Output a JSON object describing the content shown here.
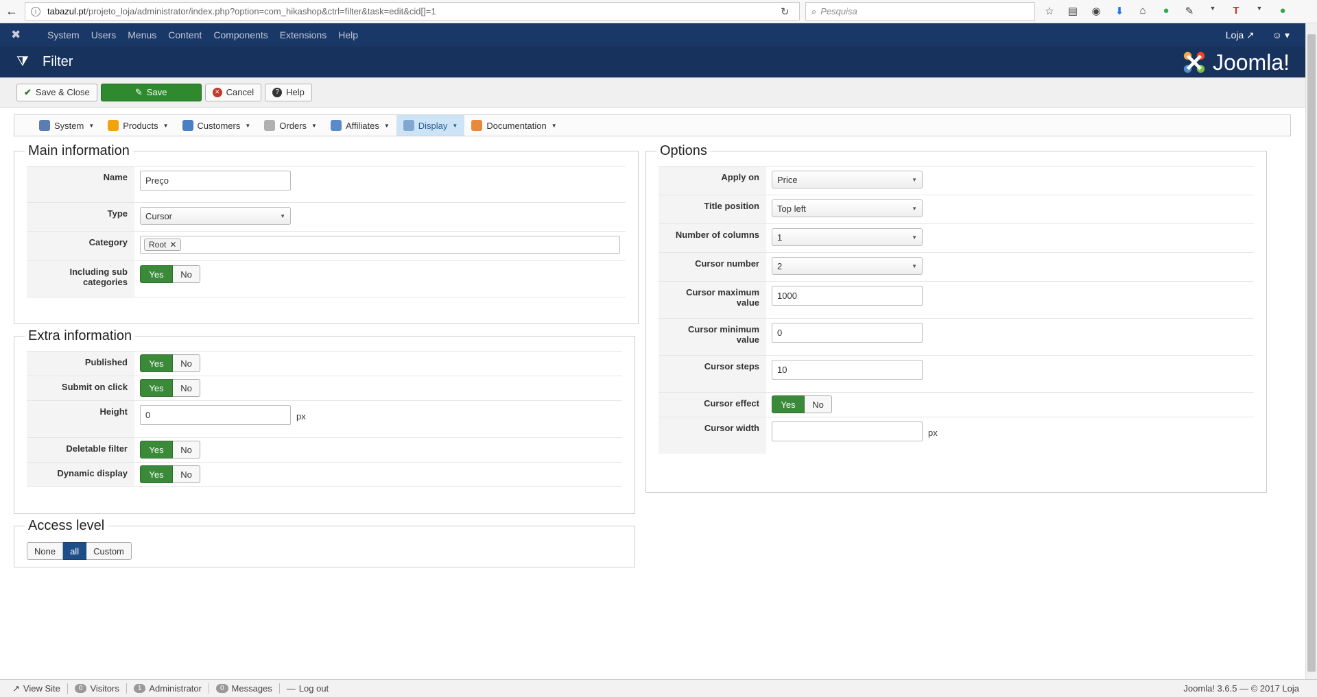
{
  "browser": {
    "url_host": "tabazul.pt",
    "url_path": "/projeto_loja/administrator/index.php?option=com_hikashop&ctrl=filter&task=edit&cid[]=1",
    "search_placeholder": "Pesquisa"
  },
  "joomla_nav": {
    "items": [
      "System",
      "Users",
      "Menus",
      "Content",
      "Components",
      "Extensions",
      "Help"
    ],
    "site_link": "Loja"
  },
  "title": "Filter",
  "brand": "Joomla!",
  "toolbar": {
    "save_close": "Save & Close",
    "save": "Save",
    "cancel": "Cancel",
    "help": "Help"
  },
  "hikashop_menu": [
    "System",
    "Products",
    "Customers",
    "Orders",
    "Affiliates",
    "Display",
    "Documentation"
  ],
  "main_info": {
    "legend": "Main information",
    "name_label": "Name",
    "name_value": "Preço",
    "type_label": "Type",
    "type_value": "Cursor",
    "category_label": "Category",
    "category_tag": "Root",
    "including_label": "Including sub categories"
  },
  "extra_info": {
    "legend": "Extra information",
    "published_label": "Published",
    "submit_label": "Submit on click",
    "height_label": "Height",
    "height_value": "0",
    "height_unit": "px",
    "deletable_label": "Deletable filter",
    "dynamic_label": "Dynamic display"
  },
  "access": {
    "legend": "Access level",
    "options": [
      "None",
      "all",
      "Custom"
    ]
  },
  "options": {
    "legend": "Options",
    "apply_on_label": "Apply on",
    "apply_on_value": "Price",
    "title_pos_label": "Title position",
    "title_pos_value": "Top left",
    "columns_label": "Number of columns",
    "columns_value": "1",
    "cursor_number_label": "Cursor number",
    "cursor_number_value": "2",
    "cursor_max_label": "Cursor maximum value",
    "cursor_max_value": "1000",
    "cursor_min_label": "Cursor minimum value",
    "cursor_min_value": "0",
    "cursor_steps_label": "Cursor steps",
    "cursor_steps_value": "10",
    "cursor_effect_label": "Cursor effect",
    "cursor_width_label": "Cursor width",
    "cursor_width_unit": "px"
  },
  "toggle": {
    "yes": "Yes",
    "no": "No"
  },
  "status": {
    "view_site": "View Site",
    "visitors_count": "0",
    "visitors": "Visitors",
    "admin_count": "1",
    "admin": "Administrator",
    "messages_count": "0",
    "messages": "Messages",
    "logout": "Log out",
    "version": "Joomla! 3.6.5 — © 2017 Loja"
  },
  "colors": {
    "nav_bg": "#1a3867",
    "title_bg": "#17325c",
    "yes_green": "#3a8a3a",
    "access_active": "#1d4e8a"
  }
}
